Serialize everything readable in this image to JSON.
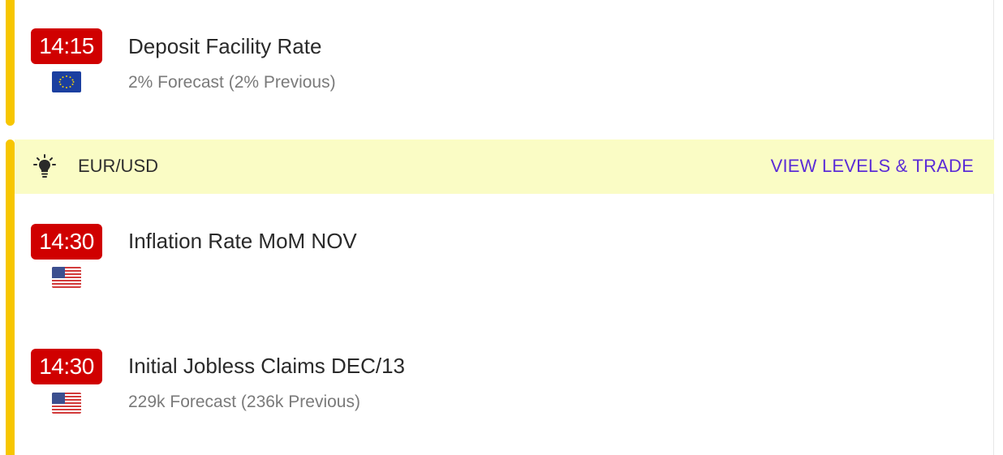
{
  "events": [
    {
      "time": "14:15",
      "flag": "eu-flag",
      "title": "Deposit Facility Rate",
      "subtitle": "2% Forecast (2% Previous)"
    },
    {
      "time": "14:30",
      "flag": "us-flag",
      "title": "Inflation Rate MoM NOV",
      "subtitle": ""
    },
    {
      "time": "14:30",
      "flag": "us-flag",
      "title": "Initial Jobless Claims DEC/13",
      "subtitle": "229k Forecast (236k Previous)"
    }
  ],
  "trade_bar": {
    "icon": "lightbulb-icon",
    "pair": "EUR/USD",
    "link_label": "VIEW LEVELS & TRADE"
  },
  "colors": {
    "accent": "#f7c600",
    "time_badge": "#d00000",
    "trade_bar_bg": "#fafcc5",
    "link": "#5b2cd6"
  }
}
